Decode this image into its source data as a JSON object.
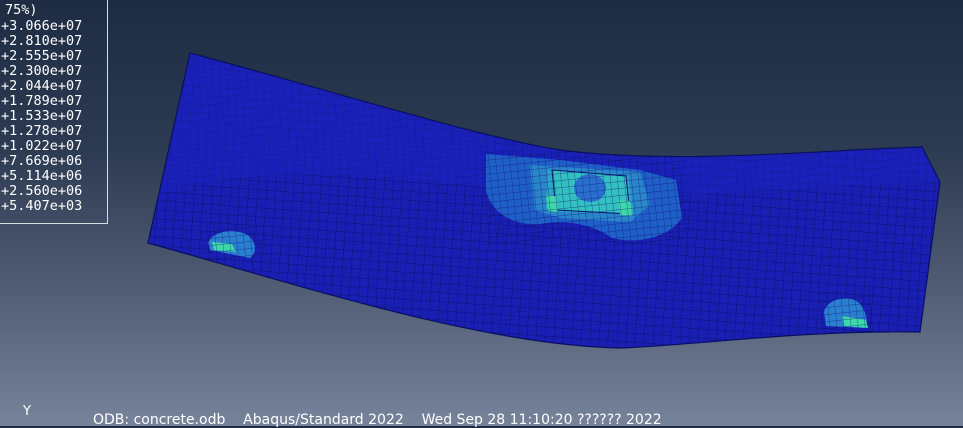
{
  "legend": {
    "header": "75%)",
    "values": [
      "+3.066e+07",
      "+2.810e+07",
      "+2.555e+07",
      "+2.300e+07",
      "+2.044e+07",
      "+1.789e+07",
      "+1.533e+07",
      "+1.278e+07",
      "+1.022e+07",
      "+7.669e+06",
      "+5.114e+06",
      "+2.560e+06",
      "+5.407e+03"
    ]
  },
  "triad": {
    "axis_label": "Y"
  },
  "status": {
    "odb": "ODB: concrete.odb",
    "solver": "Abaqus/Standard 2022",
    "date": "Wed Sep 28 11:10:20 ?????? 2022"
  },
  "colors": {
    "background_top": "#1e2c43",
    "background_bottom": "#76839a",
    "mesh_base": "#1a1fb5",
    "mesh_lines": "#08106a",
    "stress_low": "#1f5fc8",
    "stress_mid": "#2aa7c6",
    "stress_high": "#3ed8a8"
  }
}
